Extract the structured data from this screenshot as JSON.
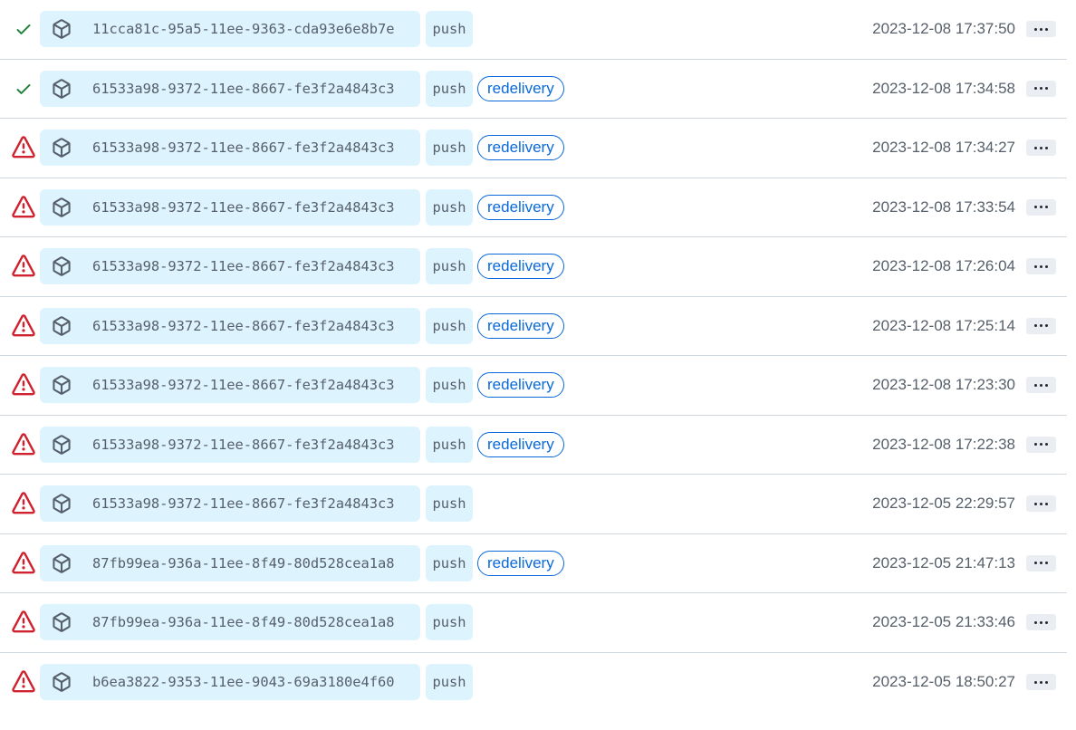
{
  "colors": {
    "success": "#1a7f37",
    "danger": "#cf222e",
    "accent": "#0969da",
    "pill_bg": "#ddf4ff"
  },
  "deliveries": [
    {
      "status": "success",
      "status_icon": "check-icon",
      "guid": "11cca81c-95a5-11ee-9363-cda93e6e8b7e",
      "event": "push",
      "redelivery": null,
      "timestamp": "2023-12-08 17:37:50"
    },
    {
      "status": "success",
      "status_icon": "check-icon",
      "guid": "61533a98-9372-11ee-8667-fe3f2a4843c3",
      "event": "push",
      "redelivery": "redelivery",
      "timestamp": "2023-12-08 17:34:58"
    },
    {
      "status": "failed",
      "status_icon": "alert-icon",
      "guid": "61533a98-9372-11ee-8667-fe3f2a4843c3",
      "event": "push",
      "redelivery": "redelivery",
      "timestamp": "2023-12-08 17:34:27"
    },
    {
      "status": "failed",
      "status_icon": "alert-icon",
      "guid": "61533a98-9372-11ee-8667-fe3f2a4843c3",
      "event": "push",
      "redelivery": "redelivery",
      "timestamp": "2023-12-08 17:33:54"
    },
    {
      "status": "failed",
      "status_icon": "alert-icon",
      "guid": "61533a98-9372-11ee-8667-fe3f2a4843c3",
      "event": "push",
      "redelivery": "redelivery",
      "timestamp": "2023-12-08 17:26:04"
    },
    {
      "status": "failed",
      "status_icon": "alert-icon",
      "guid": "61533a98-9372-11ee-8667-fe3f2a4843c3",
      "event": "push",
      "redelivery": "redelivery",
      "timestamp": "2023-12-08 17:25:14"
    },
    {
      "status": "failed",
      "status_icon": "alert-icon",
      "guid": "61533a98-9372-11ee-8667-fe3f2a4843c3",
      "event": "push",
      "redelivery": "redelivery",
      "timestamp": "2023-12-08 17:23:30"
    },
    {
      "status": "failed",
      "status_icon": "alert-icon",
      "guid": "61533a98-9372-11ee-8667-fe3f2a4843c3",
      "event": "push",
      "redelivery": "redelivery",
      "timestamp": "2023-12-08 17:22:38"
    },
    {
      "status": "failed",
      "status_icon": "alert-icon",
      "guid": "61533a98-9372-11ee-8667-fe3f2a4843c3",
      "event": "push",
      "redelivery": null,
      "timestamp": "2023-12-05 22:29:57"
    },
    {
      "status": "failed",
      "status_icon": "alert-icon",
      "guid": "87fb99ea-936a-11ee-8f49-80d528cea1a8",
      "event": "push",
      "redelivery": "redelivery",
      "timestamp": "2023-12-05 21:47:13"
    },
    {
      "status": "failed",
      "status_icon": "alert-icon",
      "guid": "87fb99ea-936a-11ee-8f49-80d528cea1a8",
      "event": "push",
      "redelivery": null,
      "timestamp": "2023-12-05 21:33:46"
    },
    {
      "status": "failed",
      "status_icon": "alert-icon",
      "guid": "b6ea3822-9353-11ee-9043-69a3180e4f60",
      "event": "push",
      "redelivery": null,
      "timestamp": "2023-12-05 18:50:27"
    }
  ]
}
